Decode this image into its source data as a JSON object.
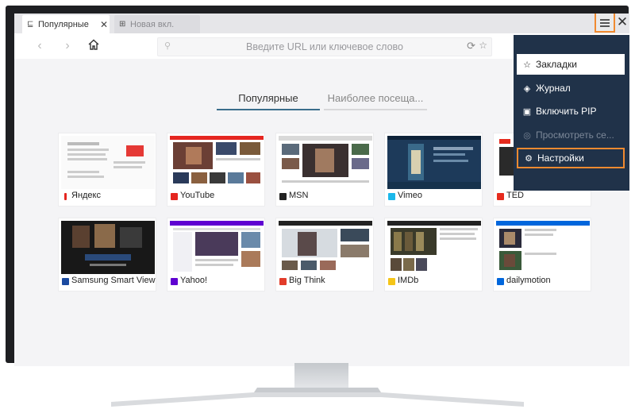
{
  "tabs": [
    {
      "label": "Популярные",
      "icon": "book-icon",
      "active": true
    },
    {
      "label": "Новая вкл.",
      "icon": "new-tab-icon",
      "active": false
    }
  ],
  "toolbar": {
    "url_placeholder": "Введите URL или ключевое слово",
    "back_icon": "chevron-left-icon",
    "forward_icon": "chevron-right-icon",
    "home_icon": "home-icon"
  },
  "quick_tabs": {
    "popular": "Популярные",
    "most_visited": "Наиболее посеща..."
  },
  "sites": [
    {
      "name": "Яндекс",
      "color": "#e52620"
    },
    {
      "name": "YouTube",
      "color": "#e52620"
    },
    {
      "name": "MSN",
      "color": "#222222"
    },
    {
      "name": "Vimeo",
      "color": "#1ab7ea"
    },
    {
      "name": "TED",
      "color": "#e62b1e"
    },
    {
      "name": "Samsung Smart View",
      "color": "#1b4aa0"
    },
    {
      "name": "Yahoo!",
      "color": "#5f01d1"
    },
    {
      "name": "Big Think",
      "color": "#e23c2a"
    },
    {
      "name": "IMDb",
      "color": "#f5c518"
    },
    {
      "name": "dailymotion",
      "color": "#0066dc"
    }
  ],
  "menu": {
    "items": [
      {
        "label": "Закладки",
        "icon": "star-icon"
      },
      {
        "label": "Журнал",
        "icon": "history-icon"
      },
      {
        "label": "Включить PIP",
        "icon": "pip-icon"
      },
      {
        "label": "Просмотреть се...",
        "icon": "view-icon"
      },
      {
        "label": "Настройки",
        "icon": "gear-icon"
      }
    ],
    "highlight_color": "#f08a30"
  }
}
